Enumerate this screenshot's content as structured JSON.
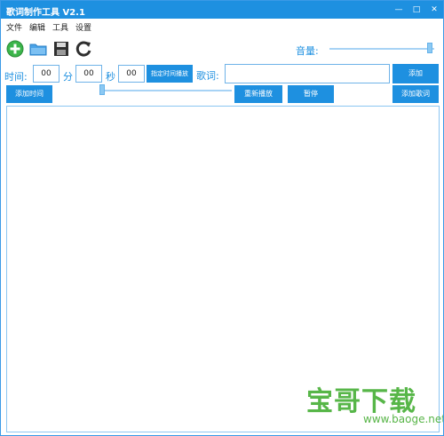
{
  "window": {
    "title": "歌词制作工具 V2.1",
    "controls": {
      "minimize": "—",
      "maximize": "□",
      "close": "✕"
    }
  },
  "menu": {
    "items": [
      "文件",
      "编辑",
      "工具",
      "设置"
    ]
  },
  "toolbar": {
    "icons": [
      "add-icon",
      "folder-icon",
      "save-icon",
      "refresh-icon"
    ],
    "volume_label": "音量:",
    "volume_level": 0.98
  },
  "time_controls": {
    "time_label": "时间:",
    "hours": "00",
    "minutes_label": "分",
    "minutes": "00",
    "seconds_label": "秒",
    "seconds": "00",
    "play_from_time": "指定时间播放"
  },
  "lyrics": {
    "label": "歌词:",
    "input_value": "",
    "add_button": "添加",
    "add_lyrics_button": "添加歌词"
  },
  "actions": {
    "add_time": "添加时间",
    "replay": "重新播放",
    "pause": "暂停"
  },
  "progress": {
    "level": 0.0
  },
  "watermark": {
    "brand": "宝哥下载",
    "url": "www.baoge.net"
  },
  "colors": {
    "accent": "#1e90e0",
    "border": "#6fb3e8",
    "watermark": "#57b648"
  }
}
